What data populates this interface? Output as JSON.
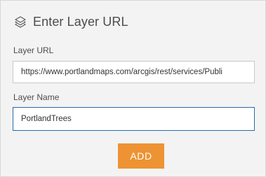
{
  "header": {
    "icon": "layers-icon",
    "title": "Enter Layer URL"
  },
  "form": {
    "url_label": "Layer URL",
    "url_value": "https://www.portlandmaps.com/arcgis/rest/services/Publi",
    "name_label": "Layer Name",
    "name_value": "PortlandTrees"
  },
  "actions": {
    "add_label": "ADD"
  },
  "colors": {
    "accent": "#ed9333",
    "focus_border": "#2a6aa7",
    "text": "#4c4c4c",
    "background": "#f3f3f3"
  }
}
